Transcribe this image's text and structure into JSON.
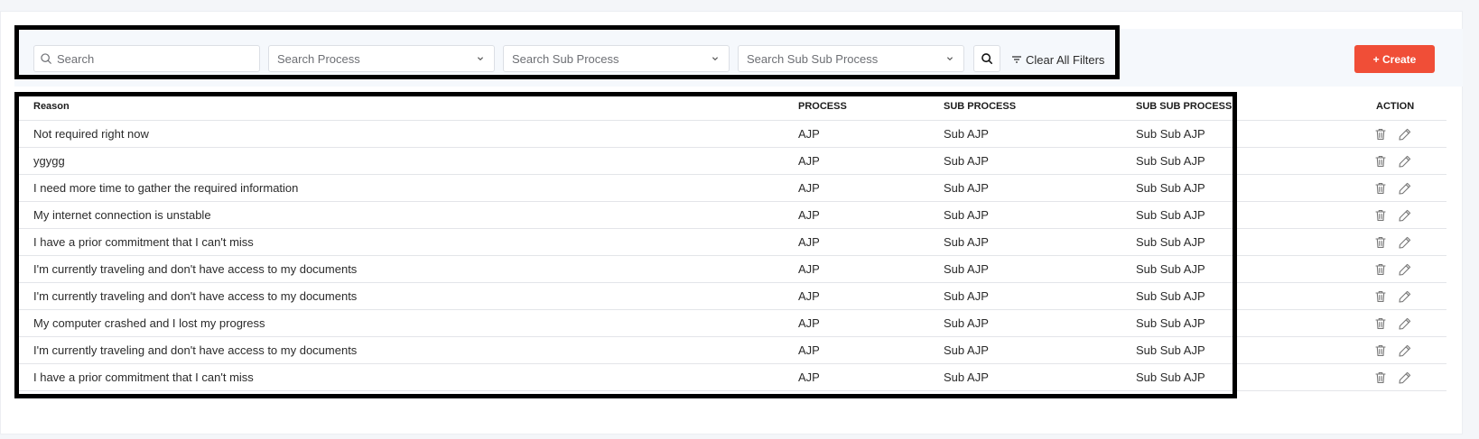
{
  "filters": {
    "search_placeholder": "Search",
    "process_placeholder": "Search Process",
    "sub_process_placeholder": "Search Sub Process",
    "sub_sub_process_placeholder": "Search Sub Sub Process",
    "clear_all_label": "Clear All Filters"
  },
  "create_label": "+ Create",
  "table": {
    "headers": {
      "reason": "Reason",
      "process": "PROCESS",
      "sub_process": "SUB PROCESS",
      "sub_sub_process": "SUB SUB PROCESS",
      "action": "ACTION"
    },
    "rows": [
      {
        "reason": "Not required right now",
        "process": "AJP",
        "sub_process": "Sub AJP",
        "sub_sub_process": "Sub Sub AJP"
      },
      {
        "reason": "ygygg",
        "process": "AJP",
        "sub_process": "Sub AJP",
        "sub_sub_process": "Sub Sub AJP"
      },
      {
        "reason": "I need more time to gather the required information",
        "process": "AJP",
        "sub_process": "Sub AJP",
        "sub_sub_process": "Sub Sub AJP"
      },
      {
        "reason": "My internet connection is unstable",
        "process": "AJP",
        "sub_process": "Sub AJP",
        "sub_sub_process": "Sub Sub AJP"
      },
      {
        "reason": "I have a prior commitment that I can't miss",
        "process": "AJP",
        "sub_process": "Sub AJP",
        "sub_sub_process": "Sub Sub AJP"
      },
      {
        "reason": "I'm currently traveling and don't have access to my documents",
        "process": "AJP",
        "sub_process": "Sub AJP",
        "sub_sub_process": "Sub Sub AJP"
      },
      {
        "reason": "I'm currently traveling and don't have access to my documents",
        "process": "AJP",
        "sub_process": "Sub AJP",
        "sub_sub_process": "Sub Sub AJP"
      },
      {
        "reason": "My computer crashed and I lost my progress",
        "process": "AJP",
        "sub_process": "Sub AJP",
        "sub_sub_process": "Sub Sub AJP"
      },
      {
        "reason": "I'm currently traveling and don't have access to my documents",
        "process": "AJP",
        "sub_process": "Sub AJP",
        "sub_sub_process": "Sub Sub AJP"
      },
      {
        "reason": "I have a prior commitment that I can't miss",
        "process": "AJP",
        "sub_process": "Sub AJP",
        "sub_sub_process": "Sub Sub AJP"
      }
    ]
  },
  "icons": {
    "search": "search-icon",
    "chevron": "chevron-down-icon",
    "filter": "filter-icon",
    "delete": "trash-icon",
    "edit": "pencil-icon"
  },
  "colors": {
    "accent": "#f04e37",
    "highlight_border": "#000000"
  }
}
